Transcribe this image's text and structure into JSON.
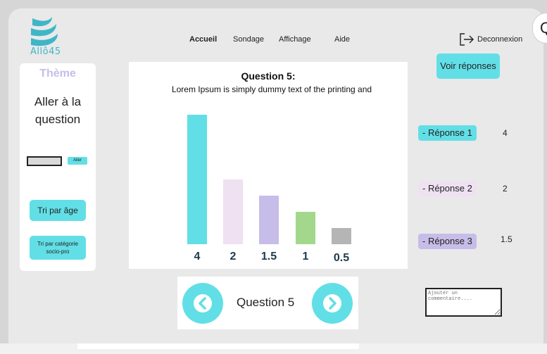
{
  "brand": {
    "name": "Allô45",
    "colors": {
      "accent": "#62dfe6",
      "theme_text": "#c7bde9"
    }
  },
  "nav": {
    "items": [
      {
        "label": "Accueil",
        "active": true
      },
      {
        "label": "Sondage",
        "active": false
      },
      {
        "label": "Affichage",
        "active": false
      },
      {
        "label": "Aide",
        "active": false
      }
    ],
    "logout_label": "Deconnexion",
    "logout_icon": "logout-arrow-icon"
  },
  "sidebar": {
    "title": "Thème",
    "goto_label": "Aller à la question",
    "goto_button": "Aller",
    "sort_age_label": "Tri par âge",
    "sort_category_label": "Tri par catégorie socio-pro"
  },
  "question": {
    "title": "Question 5:",
    "text": "Lorem Ipsum is simply dummy text of the printing and"
  },
  "chart_data": {
    "type": "bar",
    "categories": [
      "4",
      "2",
      "1.5",
      "1",
      "0.5"
    ],
    "values": [
      4,
      2,
      1.5,
      1,
      0.5
    ],
    "colors": [
      "#62dfe6",
      "#efe1f2",
      "#c7bde9",
      "#a3d88c",
      "#b5b5b5"
    ],
    "ylim": [
      0,
      4
    ]
  },
  "responses": {
    "see_button": "Voir réponses",
    "items": [
      {
        "label": "- Réponse 1",
        "value": "4",
        "color": "#62dfe6"
      },
      {
        "label": "- Réponse 2",
        "value": "2",
        "color": "#efe1f2"
      },
      {
        "label": "- Réponse 3",
        "value": "1.5",
        "color": "#c7bde9"
      }
    ]
  },
  "pager": {
    "label": "Question 5",
    "prev_icon": "chevron-left-icon",
    "next_icon": "chevron-right-icon"
  },
  "comment": {
    "placeholder": "Ajouter un commentaire...."
  }
}
